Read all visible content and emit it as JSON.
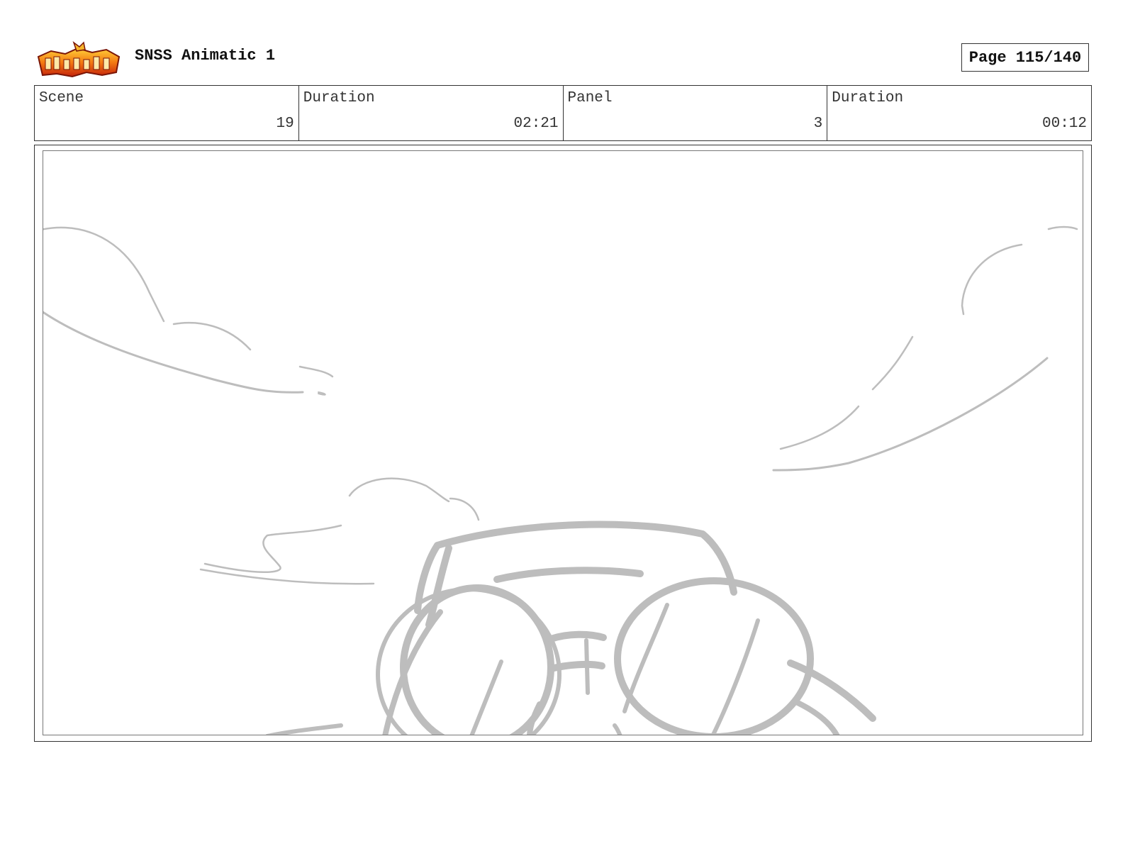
{
  "header": {
    "doc_title": "SNSS Animatic 1",
    "page_label": "Page 115/140",
    "logo_icon": "show-logo-icon"
  },
  "info": [
    {
      "label": "Scene",
      "value": "19"
    },
    {
      "label": "Duration",
      "value": "02:21"
    },
    {
      "label": "Panel",
      "value": "3"
    },
    {
      "label": "Duration",
      "value": "00:12"
    }
  ],
  "panel": {
    "sketch_color": "#bdbdbd",
    "content": "storyboard-sketch"
  }
}
